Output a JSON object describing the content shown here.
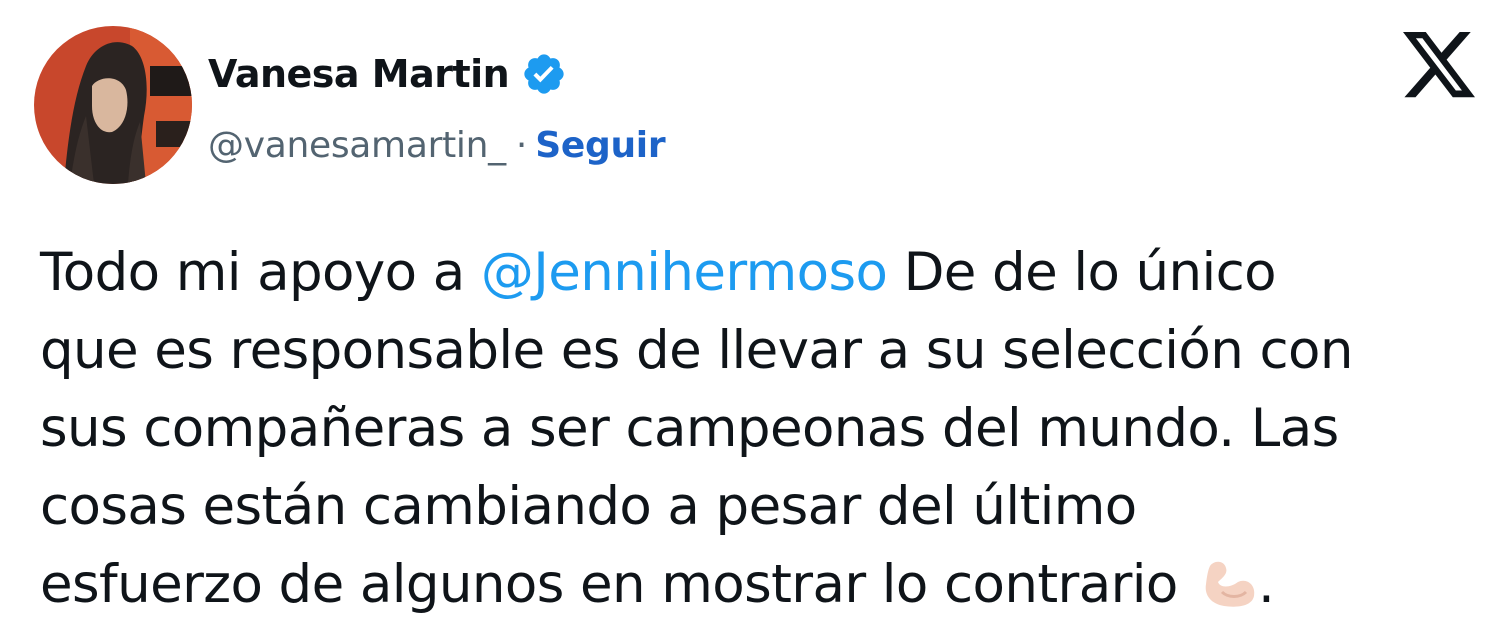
{
  "author": {
    "display_name": "Vanesa Martin",
    "handle": "@vanesamartin_",
    "separator": "·",
    "follow_label": "Seguir",
    "verified": true
  },
  "platform": {
    "logo_icon": "x-logo-icon"
  },
  "tweet": {
    "line1_before": "Todo mi apoyo a ",
    "mention": "@Jennihermoso",
    "line1_after": " De de lo único",
    "line2": "que es responsable es de llevar a su selección con",
    "line3": "sus compañeras a ser campeonas del mundo. Las",
    "line4": "cosas están cambiando a pesar del último",
    "line5_before": "esfuerzo de algunos en mostrar lo contrario ",
    "emoji": "flexed-biceps-emoji",
    "line5_after": "."
  },
  "colors": {
    "link": "#1d9bf0",
    "follow": "#1d63c8",
    "verified_badge": "#1d9bf0",
    "secondary_text": "#536471",
    "primary_text": "#0f1419"
  }
}
